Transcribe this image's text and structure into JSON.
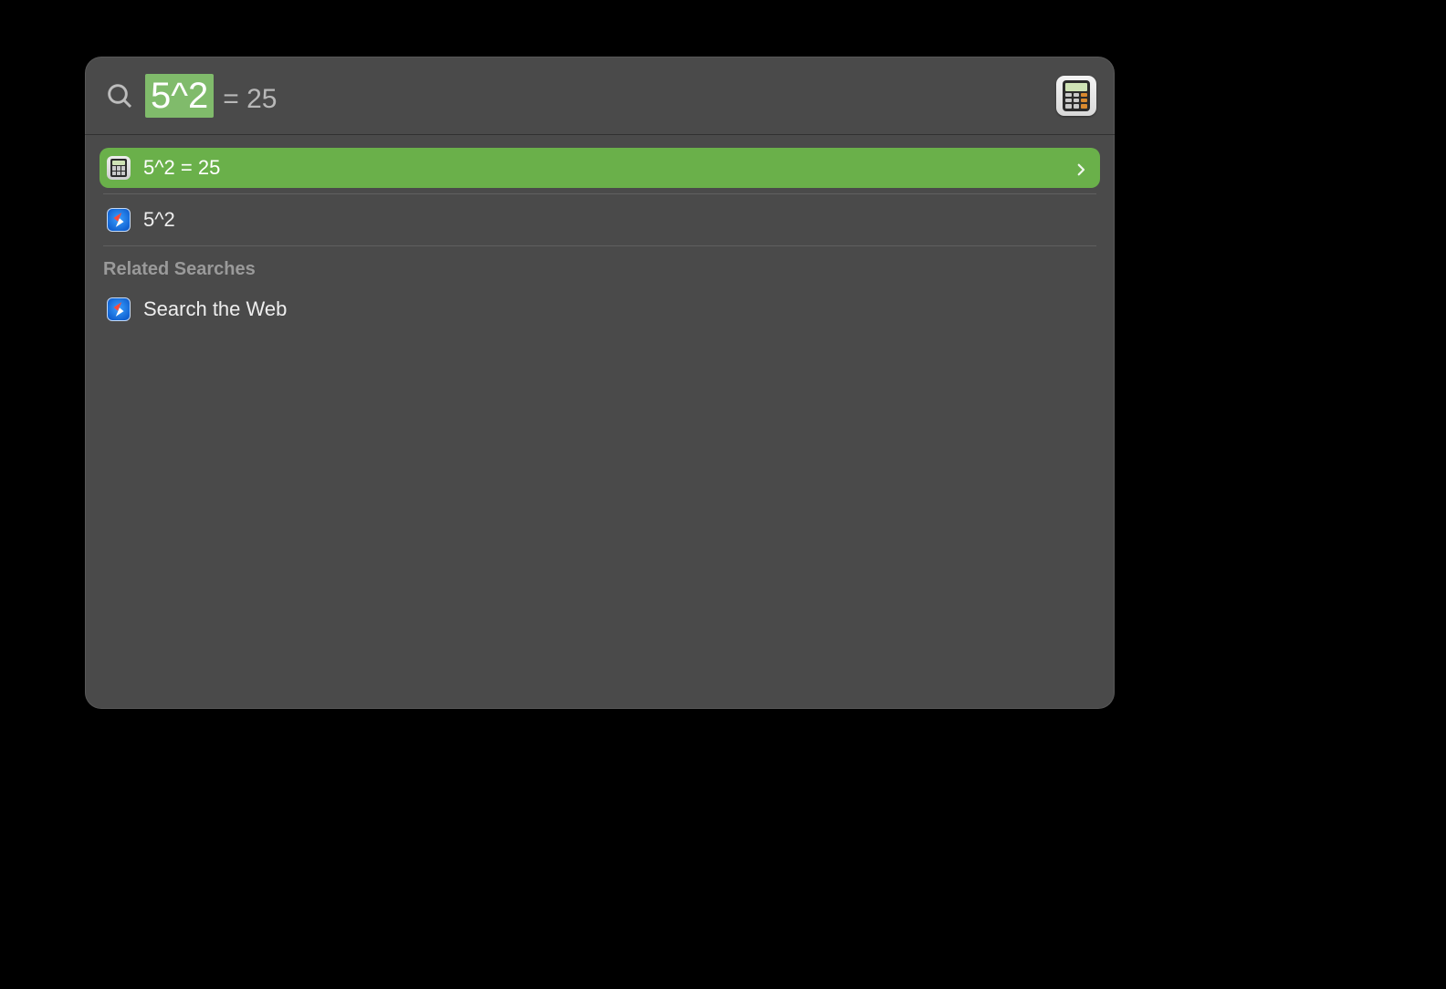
{
  "search": {
    "query": "5^2",
    "result_inline": "= 25"
  },
  "results": [
    {
      "icon": "calculator-icon",
      "label": "5^2 = 25",
      "selected": true,
      "disclosure": true
    },
    {
      "icon": "safari-icon",
      "label": "5^2",
      "selected": false,
      "disclosure": false
    }
  ],
  "sections": {
    "related_header": "Related Searches"
  },
  "related": [
    {
      "icon": "safari-icon",
      "label": "Search the Web"
    }
  ],
  "colors": {
    "selection": "#6ab04a",
    "panel": "#4a4a4a"
  }
}
